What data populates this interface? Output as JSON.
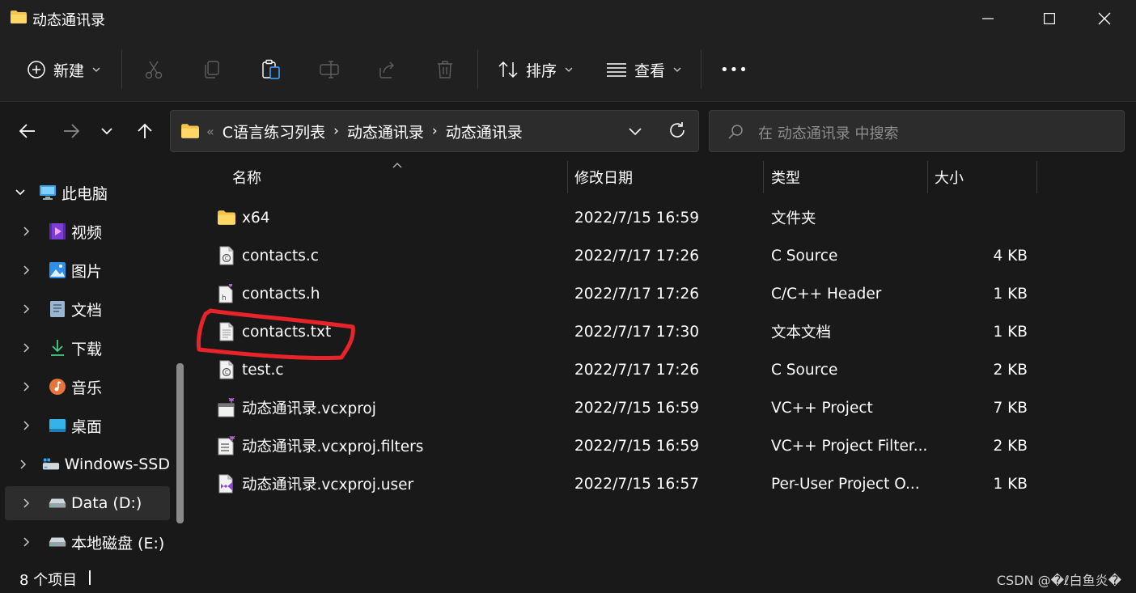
{
  "window": {
    "title": "动态通讯录"
  },
  "toolbar": {
    "new_label": "新建",
    "sort_label": "排序",
    "view_label": "查看",
    "more_label": "•••"
  },
  "address": {
    "overflow": "«",
    "segments": [
      "C语言练习列表",
      "动态通讯录",
      "动态通讯录"
    ],
    "separator": "›"
  },
  "search": {
    "placeholder": "在 动态通讯录 中搜索"
  },
  "sidebar": {
    "items": [
      {
        "label": "此电脑",
        "icon": "monitor-icon",
        "expanded": true
      },
      {
        "label": "视频",
        "icon": "video-icon"
      },
      {
        "label": "图片",
        "icon": "pictures-icon"
      },
      {
        "label": "文档",
        "icon": "documents-icon"
      },
      {
        "label": "下载",
        "icon": "download-icon"
      },
      {
        "label": "音乐",
        "icon": "music-icon"
      },
      {
        "label": "桌面",
        "icon": "desktop-icon"
      },
      {
        "label": "Windows-SSD",
        "icon": "drive-windows-icon"
      },
      {
        "label": "Data (D:)",
        "icon": "drive-icon",
        "selected": true
      },
      {
        "label": "本地磁盘 (E:)",
        "icon": "drive-icon"
      }
    ]
  },
  "columns": {
    "name": "名称",
    "date": "修改日期",
    "type": "类型",
    "size": "大小"
  },
  "files": [
    {
      "name": "x64",
      "date": "2022/7/15 16:59",
      "type": "文件夹",
      "size": "",
      "icon": "folder-icon"
    },
    {
      "name": "contacts.c",
      "date": "2022/7/17 17:26",
      "type": "C Source",
      "size": "4 KB",
      "icon": "c-source-file-icon"
    },
    {
      "name": "contacts.h",
      "date": "2022/7/17 17:26",
      "type": "C/C++ Header",
      "size": "1 KB",
      "icon": "header-file-icon"
    },
    {
      "name": "contacts.txt",
      "date": "2022/7/17 17:30",
      "type": "文本文档",
      "size": "1 KB",
      "icon": "text-file-icon"
    },
    {
      "name": "test.c",
      "date": "2022/7/17 17:26",
      "type": "C Source",
      "size": "2 KB",
      "icon": "c-source-file-icon"
    },
    {
      "name": "动态通讯录.vcxproj",
      "date": "2022/7/15 16:59",
      "type": "VC++ Project",
      "size": "7 KB",
      "icon": "vcxproj-file-icon"
    },
    {
      "name": "动态通讯录.vcxproj.filters",
      "date": "2022/7/15 16:59",
      "type": "VC++ Project Filter...",
      "size": "2 KB",
      "icon": "filters-file-icon"
    },
    {
      "name": "动态通讯录.vcxproj.user",
      "date": "2022/7/15 16:57",
      "type": "Per-User Project O...",
      "size": "1 KB",
      "icon": "user-file-icon"
    }
  ],
  "status": {
    "item_count": "8 个项目"
  },
  "watermark": "CSDN @�ℓ白鱼炎�",
  "colors": {
    "background": "#191919",
    "chrome": "#202020",
    "annotation": "#e8242a"
  }
}
